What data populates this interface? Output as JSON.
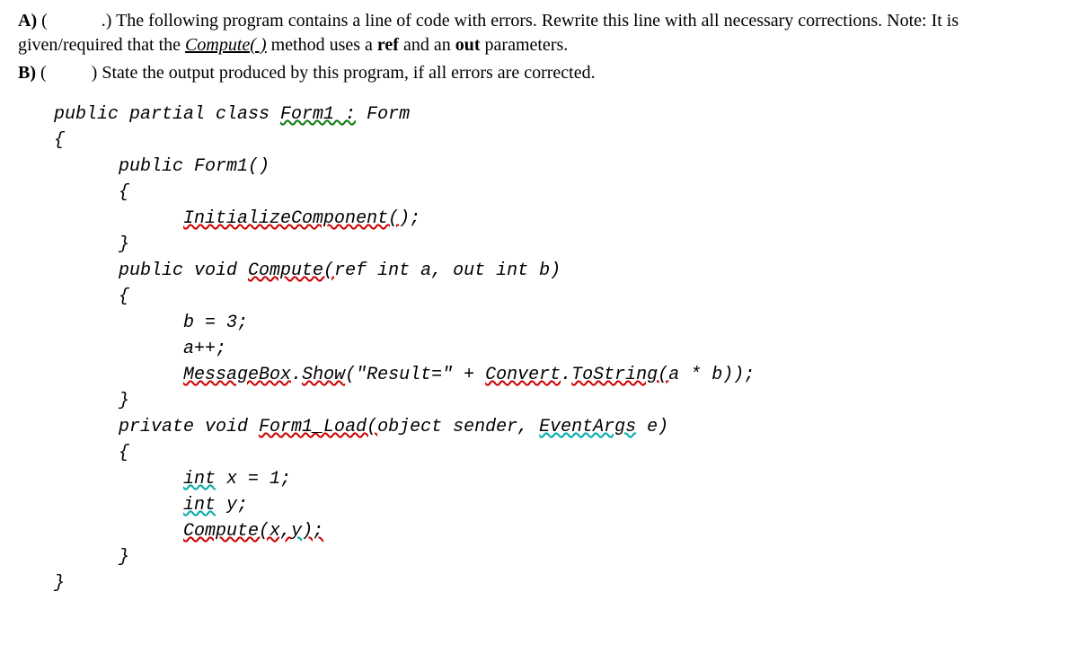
{
  "qA": {
    "label": "A)",
    "pre": "(",
    "post": ".) The following program contains a line of code with errors. Rewrite this line with all necessary corrections. Note: It is given/required that the ",
    "compute": "Compute( )",
    "afterCompute": " method uses a ",
    "ref": "ref",
    "mid": " and an ",
    "out": "out",
    "tail": " parameters."
  },
  "qB": {
    "label": "B)",
    "pre": "(",
    "post": ") State the output produced by this program, if all errors are corrected."
  },
  "code": {
    "l1a": "public partial class ",
    "l1b": "Form1 :",
    "l1c": " Form",
    "l2": "{",
    "l3": "      public Form1()",
    "l4": "      {",
    "l5a": "            ",
    "l5b": "InitializeComponent(",
    "l5c": ");",
    "l6": "      }",
    "l7a": "      public void ",
    "l7b": "Compute(",
    "l7c": "ref int a, out int b)",
    "l8": "      {",
    "l9": "            b = 3;",
    "l10": "            a++;",
    "l11a": "            ",
    "l11b": "MessageBox",
    "l11c": ".",
    "l11d": "Show",
    "l11e": "(\"Result=\" + ",
    "l11f": "Convert",
    "l11g": ".",
    "l11h": "ToString(",
    "l11i": "a * b));",
    "l12": "      }",
    "l13a": "      private void ",
    "l13b": "Form1_Load(",
    "l13c": "object sender, ",
    "l13d": "EventArgs",
    "l13e": " e)",
    "l14": "      {",
    "l15a": "            ",
    "l15b": "int",
    "l15c": " x = 1;",
    "l16a": "            ",
    "l16b": "int",
    "l16c": " y;",
    "l17a": "            ",
    "l17b": "Compute(x,",
    "l17c": "y",
    "l17d": ");",
    "l18": "      }",
    "l19": "}"
  }
}
